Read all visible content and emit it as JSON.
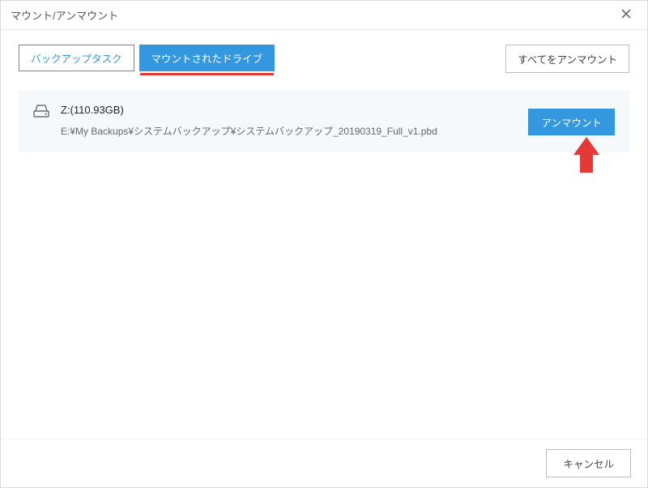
{
  "window": {
    "title": "マウント/アンマウント"
  },
  "tabs": {
    "backup_tasks": "バックアップタスク",
    "mounted_drives": "マウントされたドライブ"
  },
  "toolbar": {
    "unmount_all": "すべてをアンマウント"
  },
  "drives": [
    {
      "label": "Z:(110.93GB)",
      "path": "E:¥My Backups¥システムバックアップ¥システムバックアップ_20190319_Full_v1.pbd",
      "unmount_label": "アンマウント"
    }
  ],
  "footer": {
    "cancel": "キャンセル"
  },
  "colors": {
    "accent": "#3498e0",
    "underline": "#e53935"
  }
}
